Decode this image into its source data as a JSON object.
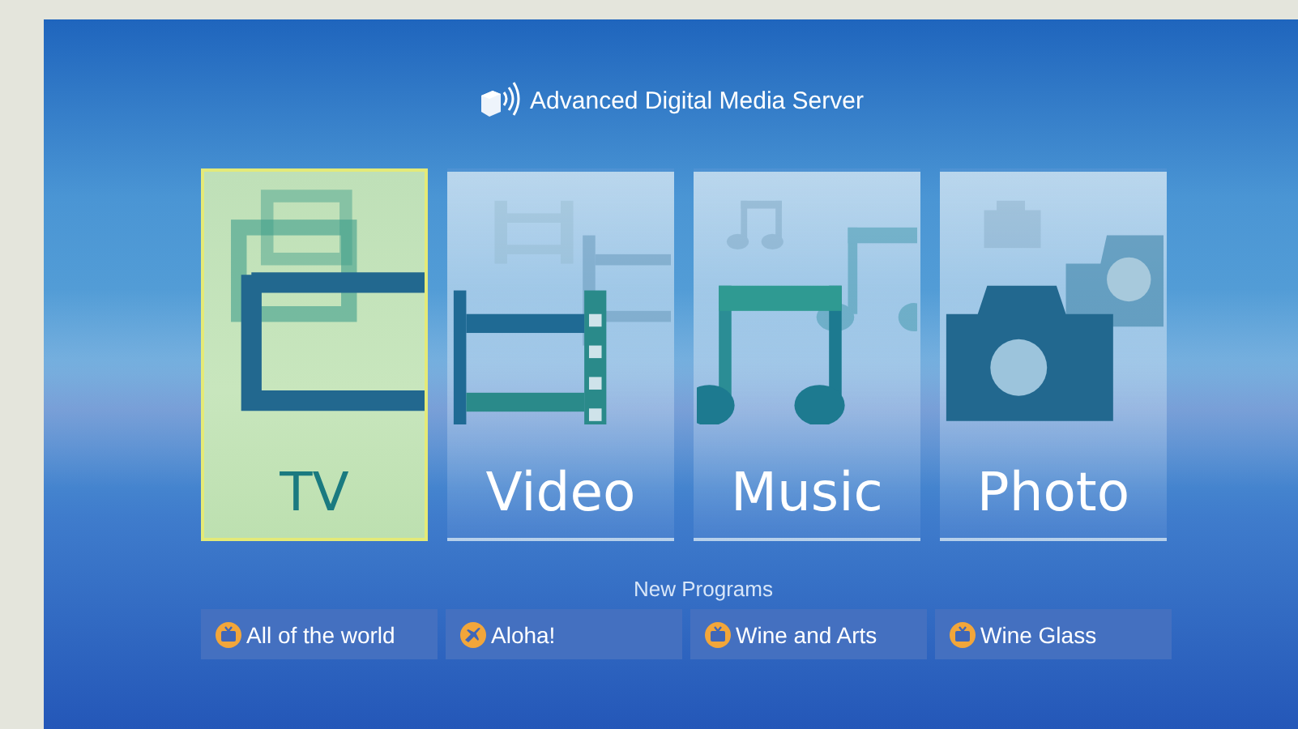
{
  "header": {
    "title": "Advanced Digital Media Server"
  },
  "categories": [
    {
      "label": "TV",
      "kind": "tv",
      "selected": true
    },
    {
      "label": "Video",
      "kind": "film",
      "selected": false
    },
    {
      "label": "Music",
      "kind": "note",
      "selected": false
    },
    {
      "label": "Photo",
      "kind": "camera",
      "selected": false
    }
  ],
  "new_programs": {
    "heading": "New Programs",
    "items": [
      {
        "title": "All of the world",
        "kind": "tv"
      },
      {
        "title": "Aloha!",
        "kind": "plane"
      },
      {
        "title": "Wine and Arts",
        "kind": "tv"
      },
      {
        "title": "Wine Glass",
        "kind": "tv"
      }
    ]
  }
}
